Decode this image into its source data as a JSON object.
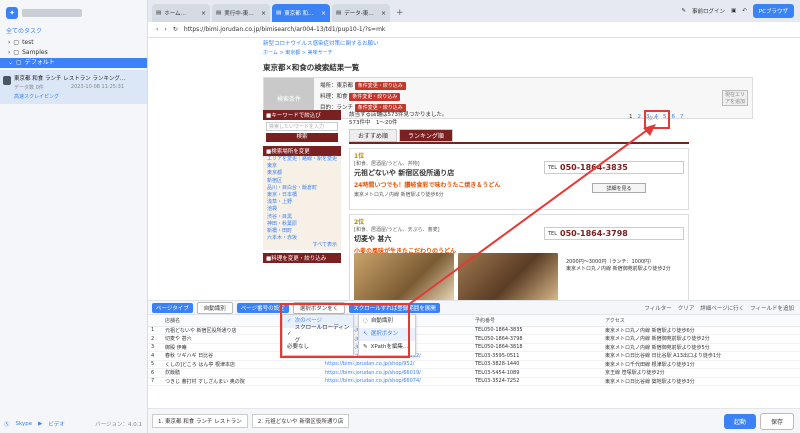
{
  "left": {
    "all_tasks": "全てのタスク",
    "folders": [
      "test",
      "Samples",
      "デフォルト"
    ],
    "task": {
      "title": "東京都 和食 ランチ レストラン ランキング…",
      "sub_label": "データ数 0件",
      "date": "2023-10-08 11:25:31",
      "tag": "高速スクレイピング"
    },
    "footer": {
      "skype": "Skype",
      "video": "ビデオ",
      "version": "バージョン：4.0.1"
    }
  },
  "tabs": [
    {
      "label": "ホーム…",
      "active": false
    },
    {
      "label": "実行中-東…",
      "active": false
    },
    {
      "label": "東京都 和…",
      "active": true
    },
    {
      "label": "データ-東…",
      "active": false
    }
  ],
  "top_right": {
    "login": "事前ログイン",
    "pc": "PCブラウザ"
  },
  "url": "https://bimi.jorudan.co.jp/bimisearch/ar004-13/td1/pup10-1/?s=mk",
  "page": {
    "notice": "新型コロナウイルス感染症対策に関するお願い",
    "crumb": "ホーム > 東京都 > 美味サーチ",
    "heading": "東京都×和食の検索結果一覧",
    "cond_label": "検索条件",
    "cond_rows": [
      "場所：東京都",
      "料理：和食",
      "目的：ランチ"
    ],
    "cond_btn": "条件変更・絞り込み",
    "cond_add": "現在エリアを追加",
    "keyword_head": "■キーワードで絞込び",
    "keyword_ph": "検索したいワードを入力",
    "search_btn": "検索",
    "area_head": "■検索場所を変更",
    "area_links": [
      "エリアを変更｜路線・駅を変更",
      "東京",
      "東京都",
      "新宿区",
      "品川・目白台・飯倉町",
      "東京・日本橋",
      "浅草・上野",
      "池袋",
      "渋谷・目黒",
      "神田・秋葉原",
      "新橋・田町",
      "六本木・赤坂",
      "すべて表示"
    ],
    "genre_head": "■料理を変更・絞り込み",
    "count_line1": "該当する店舗は573件見つかりました。",
    "count_line2": "573件中　1〜20件",
    "pager": [
      "1",
      "2",
      "3",
      "4",
      "5",
      "6",
      "7"
    ],
    "next": "次へ",
    "tab_recommend": "おすすめ順",
    "tab_ranking": "ランキング順",
    "tel_label": "TEL",
    "detail_btn": "詳細を見る",
    "shops": [
      {
        "rank": "1位",
        "genre": "[和食、居酒屋/うどん、丼物]",
        "name": "元祖どないや 新宿区役所通り店",
        "catch": "24時間いつでも！讃岐食彩で味わうたこ焼き＆うどん",
        "access": "東京メトロ丸ノ内線 新宿駅より徒歩6分",
        "tel": "050-1864-3835"
      },
      {
        "rank": "2位",
        "genre": "[和食、居酒屋/うどん、天ぷら、蕎麦]",
        "name": "切麦や 甚六",
        "catch": "小麦の風味が生きたこだわりのうどん",
        "access": "",
        "tel": "050-1864-3798",
        "price": "2000円〜3000円（ランチ：1000円）",
        "access2": "東京メトロ丸ノ内線 新宿御苑前駅より徒歩2分"
      }
    ]
  },
  "toolbar": {
    "page_type": "ページタイプ",
    "auto": "自動識別",
    "page_num_settings": "ページ番号の設定",
    "select_btn": "選択ボタンをく",
    "scroll_btn": "スクロールすれば登録範囲を展開",
    "filter": "フィルター",
    "clear": "クリア",
    "detail_go": "詳細ページに行く",
    "add_field": "フィールドを追加"
  },
  "dropdown1": [
    "次のページ",
    "スクロールローディング",
    "必要なし"
  ],
  "dropdown2": [
    "自動識別",
    "選択ボタン",
    "XPathを編集…"
  ],
  "table": {
    "headers": [
      "",
      "店舗名",
      "",
      "予約番号",
      "アクセス"
    ],
    "rows": [
      [
        "1",
        "元祖どないや 新宿区役所通り店",
        "https://bimi.jorudan.co.jp/shop/…",
        "TEL050-1864-3835",
        "東京メトロ丸ノ内線 新宿駅より徒歩6分"
      ],
      [
        "2",
        "切麦や 甚六",
        "https://bimi.jorudan.co.jp/shop/…",
        "TEL050-1864-3798",
        "東京メトロ丸ノ内線 新宿御苑前駅より徒歩2分"
      ],
      [
        "3",
        "御殿 伊庵",
        "https://bimi.jorudan.co.jp/shop/…",
        "TEL050-1864-3818",
        "東京メトロ丸ノ内線 新宿御苑前駅より徒歩5分"
      ],
      [
        "4",
        "春秋 ツギハギ 日比谷",
        "https://bimi.jorudan.co.jp/shop/63562/",
        "TEL03-3595-0511",
        "東京メトロ日比谷線 日比谷駅 A13出口より徒歩1分"
      ],
      [
        "5",
        "くしの]どころ はん亭 根津本店",
        "https://bimi.jorudan.co.jp/shop/952/",
        "TEL03-3828-1440",
        "東京メトロ千代田線 根津駅より徒歩1分"
      ],
      [
        "6",
        "炊飯膳",
        "https://bimi.jorudan.co.jp/shop/66019/",
        "TEL03-5454-1089",
        "京王線 笹塚駅より徒歩2分"
      ],
      [
        "7",
        "つきじ 蕎打村 すしざんまい 奥の院",
        "https://bimi.jorudan.co.jp/shop/66074/",
        "TEL03-3524-7252",
        "東京メトロ日比谷線 築地駅より徒歩3分"
      ]
    ]
  },
  "footer_tabs": [
    "1. 東京都 和食 ランチ レストラン",
    "2. 元祖どないや 新宿区役所通り店"
  ],
  "footer": {
    "run": "起動",
    "save": "保存"
  },
  "colors": {
    "accent": "#3b82f6",
    "brand": "#7a2020",
    "highlight": "#e53935"
  }
}
